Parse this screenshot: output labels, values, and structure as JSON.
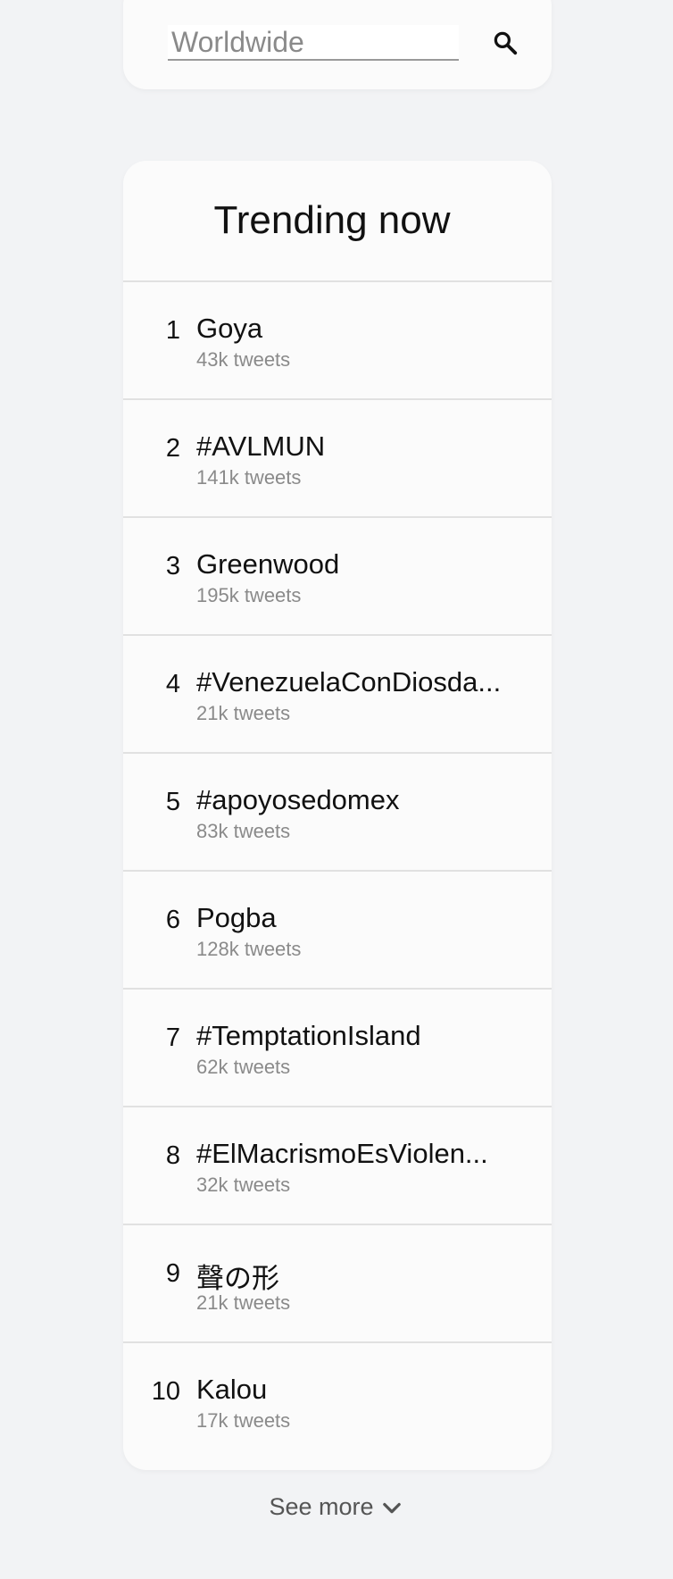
{
  "search": {
    "placeholder": "Worldwide",
    "icon": "search-icon"
  },
  "trends": {
    "title": "Trending now",
    "items": [
      {
        "rank": "1",
        "name": "Goya",
        "count": "43k tweets"
      },
      {
        "rank": "2",
        "name": "#AVLMUN",
        "count": "141k tweets"
      },
      {
        "rank": "3",
        "name": "Greenwood",
        "count": "195k tweets"
      },
      {
        "rank": "4",
        "name": "#VenezuelaConDiosda...",
        "count": "21k tweets"
      },
      {
        "rank": "5",
        "name": "#apoyosedomex",
        "count": "83k tweets"
      },
      {
        "rank": "6",
        "name": "Pogba",
        "count": "128k tweets"
      },
      {
        "rank": "7",
        "name": "#TemptationIsland",
        "count": "62k tweets"
      },
      {
        "rank": "8",
        "name": "#ElMacrismoEsViolen...",
        "count": "32k tweets"
      },
      {
        "rank": "9",
        "name": "聲の形",
        "count": "21k tweets"
      },
      {
        "rank": "10",
        "name": "Kalou",
        "count": "17k tweets"
      }
    ]
  },
  "footer": {
    "see_more_label": "See more",
    "icon": "chevron-down-icon"
  },
  "colors": {
    "background": "#f2f3f5",
    "card": "#fbfbfb",
    "divider": "#e1e1e1",
    "muted_text": "#8a8a8a"
  }
}
